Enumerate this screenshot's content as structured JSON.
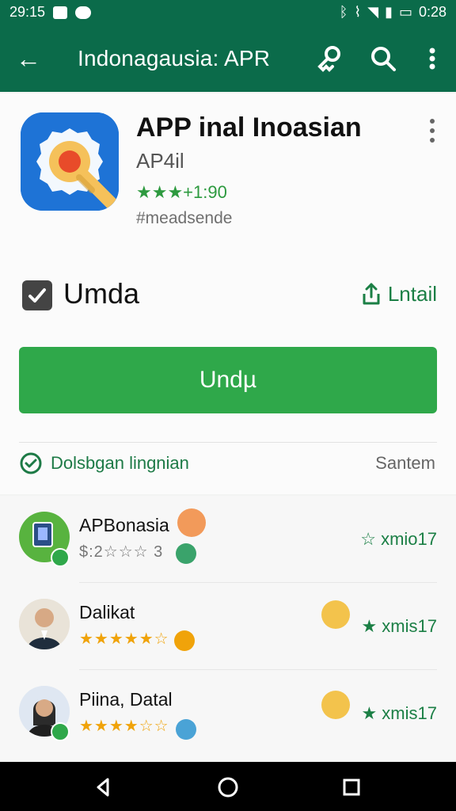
{
  "status_bar": {
    "time": "29:15",
    "right_time": "0:28"
  },
  "app_bar": {
    "title": "Indonagausia: APR",
    "back_icon": "back-arrow-icon",
    "icons": [
      "account-key-icon",
      "search-icon",
      "more-vert-icon"
    ]
  },
  "app": {
    "name": "APP inal Inoasian",
    "developer": "AP4il",
    "rating_text": "★★★+1:90",
    "tags": "#meadsende"
  },
  "actions": {
    "checkbox_label": "Umda",
    "install_label": "Lntail",
    "button_label": "Undµ"
  },
  "verification": {
    "label": "Dolsbgan lingnian",
    "save_label": "Santem"
  },
  "reviews": [
    {
      "name": "APBonasia",
      "stars_text": "$:2☆☆☆ 3",
      "meta": "☆ xmio17"
    },
    {
      "name": "Dalikat",
      "stars_text": "★★★★★☆",
      "meta": "★ xmis17"
    },
    {
      "name": "Piina, Datal",
      "stars_text": "★★★★☆☆",
      "meta": "★ xmis17"
    }
  ],
  "colors": {
    "primary": "#0b6b4a",
    "button": "#2fa84a",
    "accent_text": "#1b7f45"
  }
}
